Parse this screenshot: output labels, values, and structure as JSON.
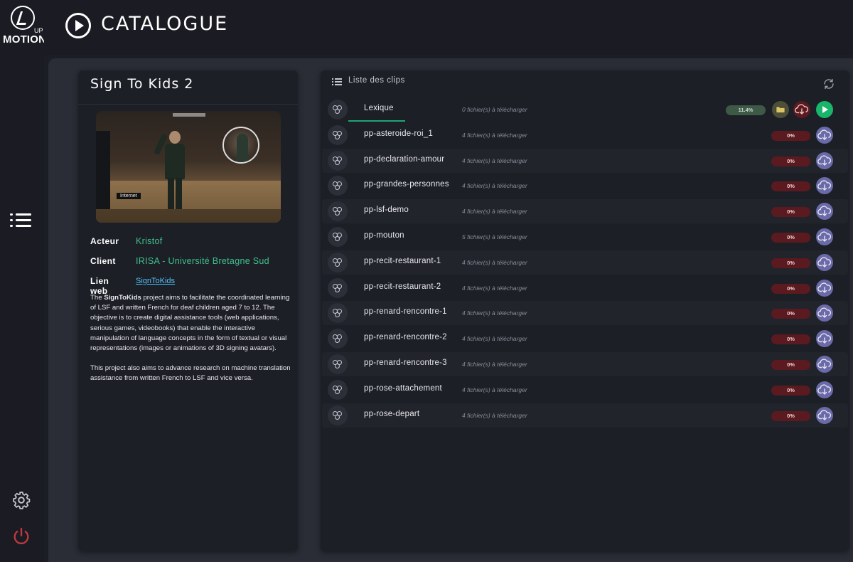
{
  "app": {
    "logo_text": "MOTION",
    "logo_sup": "UP"
  },
  "header": {
    "title": "CATALOGUE"
  },
  "project": {
    "title": "Sign To Kids 2",
    "thumbnail_label": "Internet",
    "actor_label": "Acteur",
    "actor": "Kristof",
    "client_label": "Client",
    "client": "IRISA - Université Bretagne Sud",
    "link_label": "Lien web",
    "link_text": "SignToKids",
    "desc_name": "SignToKids",
    "desc_p1_before": "The ",
    "desc_p1_after": " project aims to facilitate the coordinated learning of LSF and written French for deaf children aged 7 to 12. The objective is to create digital assistance tools (web applications, serious games, videobooks) that enable the interactive manipulation of language concepts in the form of textual or visual representations (images or animations of 3D signing avatars).",
    "desc_p2": "This project also aims to advance research on machine translation assistance from written French to LSF and vice versa."
  },
  "clips": {
    "title": "Liste des clips",
    "items": [
      {
        "name": "Lexique",
        "files": "0 fichier(s) à télécharger",
        "progress": "11.4%",
        "downloaded": true
      },
      {
        "name": "pp-asteroide-roi_1",
        "files": "4 fichier(s) à télécharger",
        "progress": "0%"
      },
      {
        "name": "pp-declaration-amour",
        "files": "4 fichier(s) à télécharger",
        "progress": "0%"
      },
      {
        "name": "pp-grandes-personnes",
        "files": "4 fichier(s) à télécharger",
        "progress": "0%"
      },
      {
        "name": "pp-lsf-demo",
        "files": "4 fichier(s) à télécharger",
        "progress": "0%"
      },
      {
        "name": "pp-mouton",
        "files": "5 fichier(s) à télécharger",
        "progress": "0%"
      },
      {
        "name": "pp-recit-restaurant-1",
        "files": "4 fichier(s) à télécharger",
        "progress": "0%"
      },
      {
        "name": "pp-recit-restaurant-2",
        "files": "4 fichier(s) à télécharger",
        "progress": "0%"
      },
      {
        "name": "pp-renard-rencontre-1",
        "files": "4 fichier(s) à télécharger",
        "progress": "0%"
      },
      {
        "name": "pp-renard-rencontre-2",
        "files": "4 fichier(s) à télécharger",
        "progress": "0%"
      },
      {
        "name": "pp-renard-rencontre-3",
        "files": "4 fichier(s) à télécharger",
        "progress": "0%"
      },
      {
        "name": "pp-rose-attachement",
        "files": "4 fichier(s) à télécharger",
        "progress": "0%"
      },
      {
        "name": "pp-rose-depart",
        "files": "4 fichier(s) à télécharger",
        "progress": "0%"
      }
    ]
  },
  "colors": {
    "accent_green": "#3fc18b",
    "link_blue": "#4fc3f7",
    "badge_red": "#5a1a1f",
    "cloud_purple": "#6b6aa8",
    "play_green": "#18b56a",
    "power_red": "#c0393f"
  },
  "icons": [
    "play-circle-icon",
    "list-icon",
    "gear-icon",
    "power-icon",
    "refresh-icon",
    "asset-icon",
    "folder-icon",
    "cloud-download-icon",
    "play-icon"
  ]
}
